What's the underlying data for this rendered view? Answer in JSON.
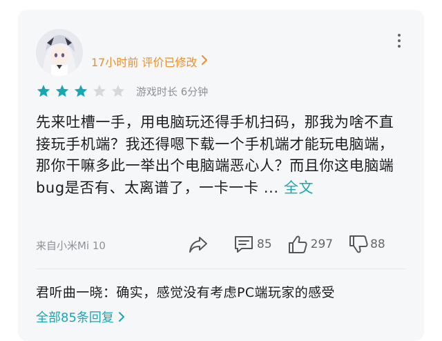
{
  "review": {
    "time_label": "17小时前 评价已修改",
    "rating": 3,
    "rating_max": 5,
    "playtime": "游戏时长 6分钟",
    "text": "先来吐槽一手，用电脑玩还得手机扫码，那我为啥不直接玩手机端？我还得嗯下载一个手机端才能玩电脑端，那你干嘛多此一举出个电脑端恶心人？而且你这电脑端bug是否有、太离谱了，一卡一卡 ...",
    "full_text_link": "全文",
    "device": "来自小米Mi 10",
    "comments": "85",
    "likes": "297",
    "dislikes": "88"
  },
  "reply_preview": {
    "text": "君听曲一晓：确实，感觉没有考虑PC端玩家的感受",
    "all_replies": "全部85条回复"
  },
  "colors": {
    "accent": "#17a7b3",
    "time_orange": "#e8902a",
    "star_filled": "#17a7b3",
    "star_empty": "#d6d8dc"
  },
  "icons": [
    "more-vertical-icon",
    "star-icon",
    "share-icon",
    "comment-icon",
    "thumbs-up-icon",
    "thumbs-down-icon",
    "chevron-right-icon"
  ]
}
